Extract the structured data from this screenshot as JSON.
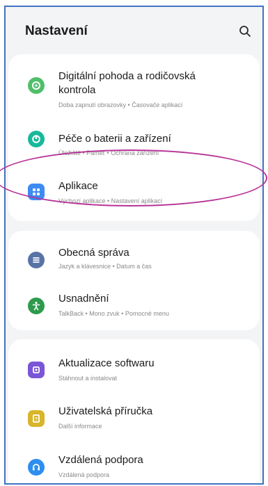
{
  "header": {
    "title": "Nastavení",
    "search_icon": "search-icon"
  },
  "colors": {
    "frame_border": "#3f73c2",
    "highlight_ellipse": "#b73297",
    "digital_wellbeing": "#4fbf6a",
    "battery_care": "#18b89a",
    "apps": "#3d8bf2",
    "general_management": "#5873a6",
    "accessibility": "#2e9a4d",
    "software_update": "#7a56d6",
    "user_manual": "#d8b52a",
    "remote_support": "#2d8ef0"
  },
  "sections": [
    {
      "items": [
        {
          "id": "digital-wellbeing",
          "label_line1": "Digitální pohoda a rodičovská",
          "label_line2": "kontrola",
          "subtitle": "Doba zapnutí obrazovky • Časovače aplikací",
          "icon": "digital-wellbeing-icon"
        },
        {
          "id": "battery-device-care",
          "label": "Péče o baterii a zařízení",
          "subtitle": "Úložiště • Paměť • Ochrana zařízení",
          "icon": "device-care-icon"
        },
        {
          "id": "apps",
          "label": "Aplikace",
          "subtitle": "Výchozí aplikace • Nastavení aplikací",
          "icon": "apps-icon"
        }
      ]
    },
    {
      "items": [
        {
          "id": "general-management",
          "label": "Obecná správa",
          "subtitle": "Jazyk a klávesnice • Datum a čas",
          "icon": "general-management-icon"
        },
        {
          "id": "accessibility",
          "label": "Usnadnění",
          "subtitle": "TalkBack • Mono zvuk • Pomocné menu",
          "icon": "accessibility-icon"
        }
      ]
    },
    {
      "items": [
        {
          "id": "software-update",
          "label": "Aktualizace softwaru",
          "subtitle": "Stáhnout a instalovat",
          "icon": "software-update-icon"
        },
        {
          "id": "user-manual",
          "label": "Uživatelská příručka",
          "subtitle": "Další informace",
          "icon": "user-manual-icon"
        },
        {
          "id": "remote-support",
          "label": "Vzdálená podpora",
          "subtitle": "Vzdálená podpora",
          "icon": "remote-support-icon"
        }
      ]
    }
  ]
}
